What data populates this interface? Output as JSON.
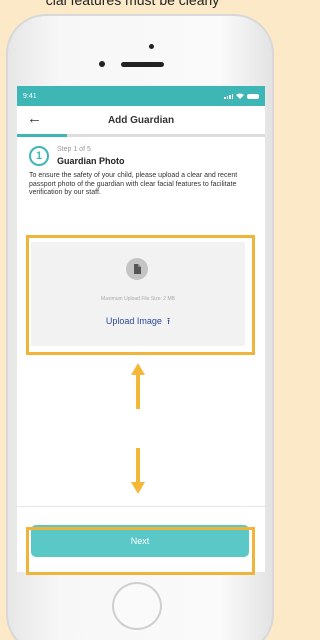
{
  "caption": "cial features must be clearly",
  "status_bar": {
    "time": "9:41",
    "color": "#3fb6b6"
  },
  "header": {
    "title": "Add Guardian",
    "back_icon": "arrow-left-icon"
  },
  "step": {
    "number": "1",
    "label": "Step 1 of 5",
    "title": "Guardian Photo",
    "progress": 0.2
  },
  "description": "To ensure the safety of your child, please upload a clear and recent passport photo of the guardian with clear facial features to facilitate verification by our staff.",
  "upload": {
    "max_size": "Maximum Upload File Size: 2 MB",
    "label": "Upload Image",
    "icon": "upload-icon",
    "file_icon": "file-icon"
  },
  "next_button": {
    "label": "Next",
    "color": "#5bc8c8"
  },
  "annotation": {
    "color": "#f0b43a"
  }
}
